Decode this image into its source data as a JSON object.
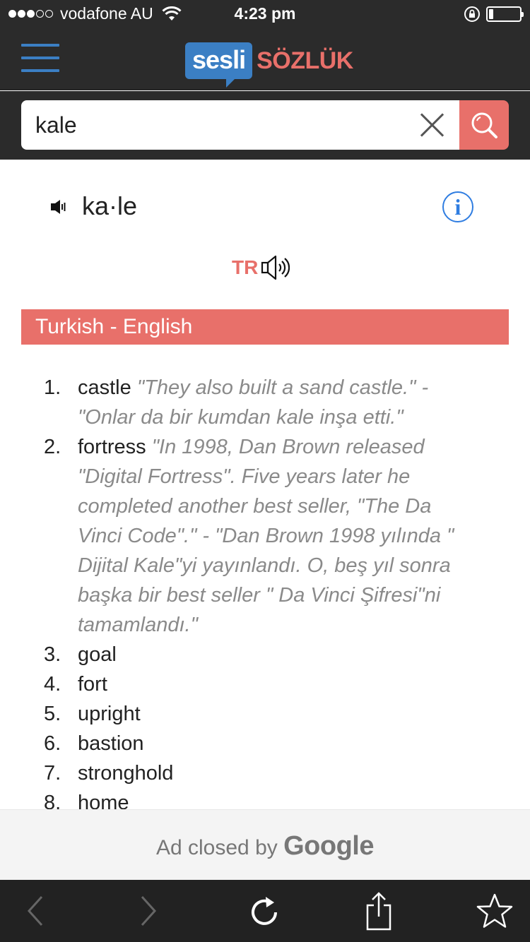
{
  "status_bar": {
    "carrier": "vodafone AU",
    "time": "4:23 pm",
    "signal_bars_filled": 3,
    "signal_bars_total": 5,
    "battery_level": 0.15
  },
  "header": {
    "logo_sesli": "sesli",
    "logo_sozluk": "SÖZLÜK",
    "menu_icon": "hamburger-icon"
  },
  "search": {
    "value": "kale",
    "clear_icon": "close-icon",
    "search_icon": "search-icon"
  },
  "word": {
    "title": "ka·le",
    "speaker_icon": "speaker-icon",
    "info_icon": "info-icon",
    "info_glyph": "i",
    "lang_label": "TR"
  },
  "section": {
    "title": "Turkish - English"
  },
  "definitions": [
    {
      "num": "1.",
      "term": "castle",
      "example": "\"They also built a sand castle.\" - \"Onlar da bir kumdan kale inşa etti.\""
    },
    {
      "num": "2.",
      "term": "fortress",
      "example": "\"In 1998, Dan Brown released \"Digital Fortress\". Five years later he completed another best seller, \"The Da Vinci Code\".\" - \"Dan Brown 1998 yılında \" Dijital Kale\"yi yayınlandı. O, beş yıl sonra başka bir best seller \" Da Vinci Şifresi\"ni tamamlandı.\""
    },
    {
      "num": "3.",
      "term": "goal",
      "example": ""
    },
    {
      "num": "4.",
      "term": "fort",
      "example": ""
    },
    {
      "num": "5.",
      "term": "upright",
      "example": ""
    },
    {
      "num": "6.",
      "term": "bastion",
      "example": ""
    },
    {
      "num": "7.",
      "term": "stronghold",
      "example": ""
    },
    {
      "num": "8.",
      "term": "home",
      "example": ""
    }
  ],
  "ad": {
    "text": "Ad closed by",
    "brand": "Google"
  },
  "toolbar": {
    "back_icon": "back-chevron-icon",
    "forward_icon": "forward-chevron-icon",
    "reload_icon": "reload-icon",
    "share_icon": "share-icon",
    "bookmark_icon": "star-icon"
  },
  "colors": {
    "accent": "#e8706a",
    "brand_blue": "#3b7fc4",
    "dark_bg": "#2b2b2b",
    "info_blue": "#2f7de1"
  }
}
